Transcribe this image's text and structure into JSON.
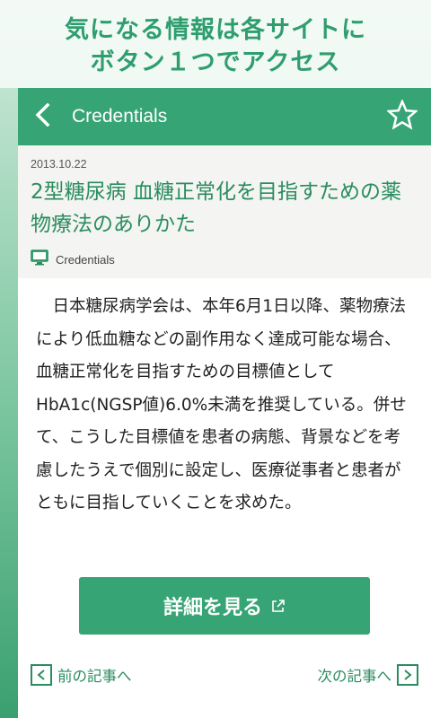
{
  "promo": {
    "line1": "気になる情報は各サイトに",
    "line2": "ボタン１つでアクセス"
  },
  "appbar": {
    "title": "Credentials",
    "back_icon": "chevron-left-icon",
    "favorite_icon": "star-outline-icon"
  },
  "article": {
    "date": "2013.10.22",
    "title": "2型糖尿病 血糖正常化を目指すための薬物療法のありかた",
    "source_icon": "monitor-icon",
    "source": "Credentials",
    "body": "日本糖尿病学会は、本年6月1日以降、薬物療法により低血糖などの副作用なく達成可能な場合、血糖正常化を目指すための目標値としてHbA1c(NGSP値)6.0%未満を推奨している。併せて、こうした目標値を患者の病態、背景などを考慮したうえで個別に設定し、医療従事者と患者がともに目指していくことを求めた。"
  },
  "detail_button": {
    "label": "詳細を見る",
    "icon": "external-link-icon"
  },
  "nav": {
    "prev_label": "前の記事へ",
    "next_label": "次の記事へ"
  },
  "colors": {
    "accent": "#36a474",
    "title_green": "#2a8d5f"
  }
}
